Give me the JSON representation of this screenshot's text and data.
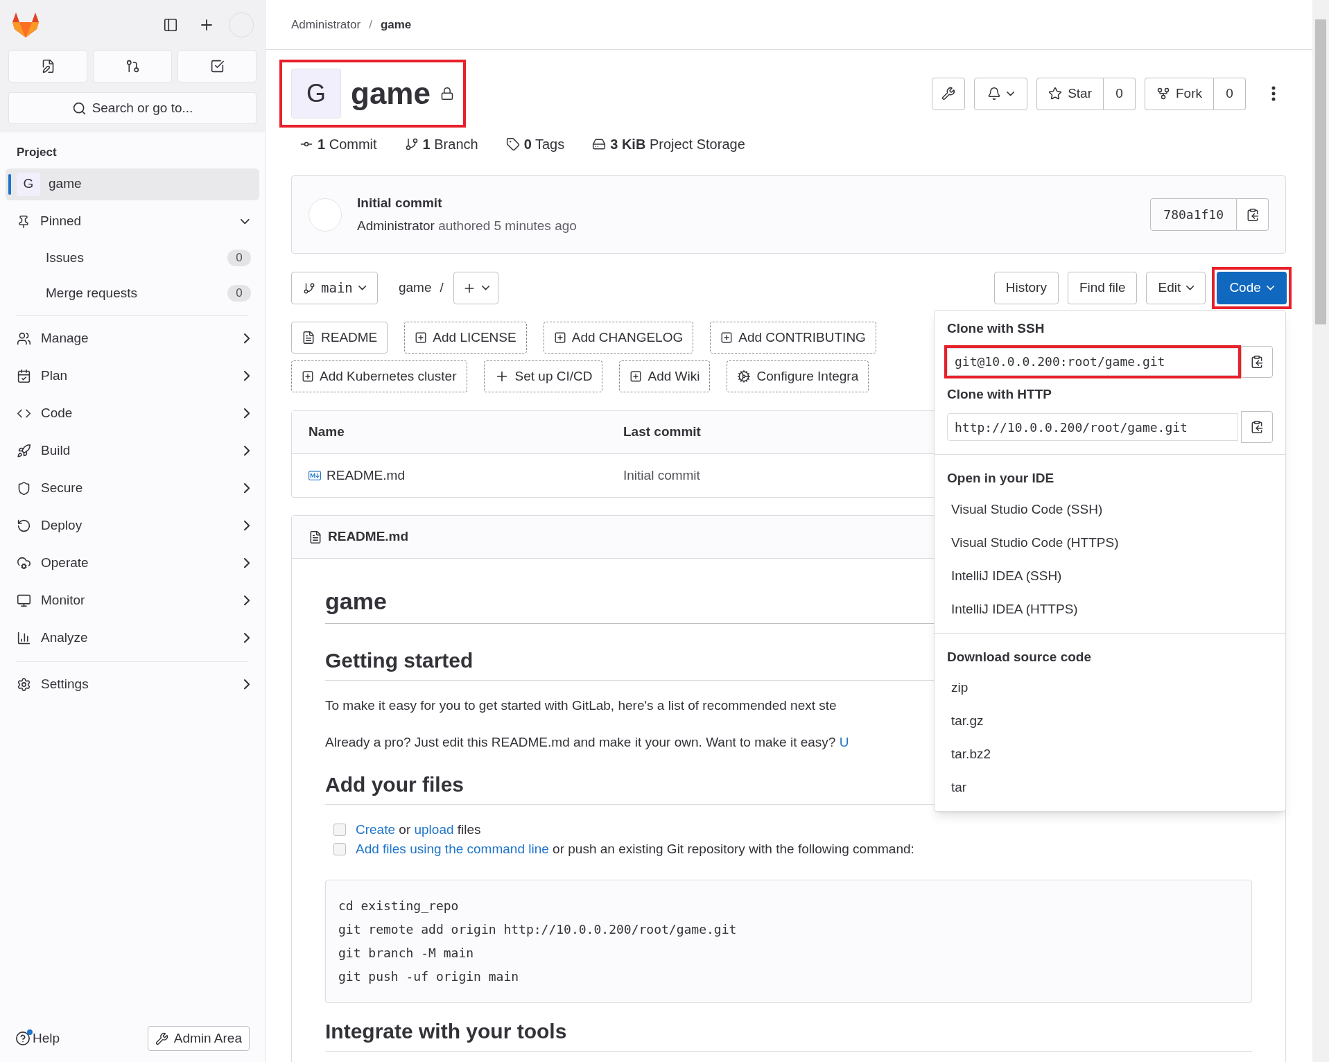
{
  "sidebar": {
    "search": {
      "placeholder": "Search or go to..."
    },
    "section_title": "Project",
    "items": [
      {
        "kind": "project",
        "avatar": "G",
        "label": "game",
        "selected": true
      },
      {
        "kind": "group",
        "label": "Pinned",
        "expanded": true,
        "children": [
          {
            "label": "Issues",
            "count": "0"
          },
          {
            "label": "Merge requests",
            "count": "0"
          }
        ]
      },
      {
        "kind": "divider"
      },
      {
        "kind": "nav",
        "label": "Manage"
      },
      {
        "kind": "nav",
        "label": "Plan"
      },
      {
        "kind": "nav",
        "label": "Code"
      },
      {
        "kind": "nav",
        "label": "Build"
      },
      {
        "kind": "nav",
        "label": "Secure"
      },
      {
        "kind": "nav",
        "label": "Deploy"
      },
      {
        "kind": "nav",
        "label": "Operate"
      },
      {
        "kind": "nav",
        "label": "Monitor"
      },
      {
        "kind": "nav",
        "label": "Analyze"
      },
      {
        "kind": "divider"
      },
      {
        "kind": "nav",
        "label": "Settings"
      }
    ],
    "help": {
      "label": "Help",
      "notification": true
    },
    "admin": "Admin Area"
  },
  "breadcrumb": {
    "items": [
      "Administrator",
      "game"
    ],
    "separator": "/"
  },
  "project": {
    "avatar": "G",
    "name": "game",
    "highlighted": true
  },
  "actions": {
    "star": {
      "label": "Star",
      "count": "0"
    },
    "fork": {
      "label": "Fork",
      "count": "0"
    }
  },
  "stats": [
    {
      "value": "1",
      "label": "Commit"
    },
    {
      "value": "1",
      "label": "Branch"
    },
    {
      "value": "0",
      "label": "Tags"
    },
    {
      "value": "3 KiB",
      "label": "Project Storage"
    }
  ],
  "commit": {
    "title": "Initial commit",
    "author": "Administrator",
    "meta": "authored 5 minutes ago",
    "sha": "780a1f10"
  },
  "toolbar": {
    "branch": "main",
    "path": "game",
    "separator": "/",
    "buttons": [
      "History",
      "Find file"
    ],
    "edit": "Edit",
    "code": {
      "label": "Code",
      "highlighted": true
    }
  },
  "shortcuts": [
    {
      "kind": "file",
      "label": "README"
    },
    {
      "kind": "add",
      "label": "Add LICENSE"
    },
    {
      "kind": "add",
      "label": "Add CHANGELOG"
    },
    {
      "kind": "add",
      "label": "Add CONTRIBUTING"
    },
    {
      "kind": "add",
      "label": "Add Kubernetes cluster"
    },
    {
      "kind": "plus",
      "label": "Set up CI/CD"
    },
    {
      "kind": "add",
      "label": "Add Wiki"
    },
    {
      "kind": "gear",
      "label": "Configure Integra"
    }
  ],
  "table": {
    "columns": [
      "Name",
      "Last commit"
    ],
    "rows": [
      {
        "name": "README.md",
        "last_commit": "Initial commit"
      }
    ]
  },
  "readme": {
    "filename": "README.md",
    "blocks": [
      {
        "kind": "h1",
        "text": "game"
      },
      {
        "kind": "h2",
        "text": "Getting started"
      },
      {
        "kind": "p",
        "parts": [
          {
            "text": "To make it easy for you to get started with GitLab, here's a list of recommended next ste"
          }
        ]
      },
      {
        "kind": "p",
        "parts": [
          {
            "text": "Already a pro? Just edit this README.md and make it your own. Want to make it easy? "
          },
          {
            "text": "U",
            "link": true
          }
        ]
      },
      {
        "kind": "h2",
        "text": "Add your files"
      },
      {
        "kind": "task",
        "checked": false,
        "parts": [
          {
            "text": "Create",
            "link": true
          },
          {
            "text": " or "
          },
          {
            "text": "upload",
            "link": true
          },
          {
            "text": " files"
          }
        ]
      },
      {
        "kind": "task",
        "checked": false,
        "parts": [
          {
            "text": "Add files using the command line",
            "link": true
          },
          {
            "text": " or push an existing Git repository with the following command:"
          }
        ]
      },
      {
        "kind": "code",
        "lines": [
          "cd existing_repo",
          "git remote add origin http://10.0.0.200/root/game.git",
          "git branch -M main",
          "git push -uf origin main"
        ]
      },
      {
        "kind": "h2",
        "text": "Integrate with your tools"
      }
    ]
  },
  "dropdown": {
    "clone": [
      {
        "title": "Clone with SSH",
        "value": "git@10.0.0.200:root/game.git",
        "highlighted": true
      },
      {
        "title": "Clone with HTTP",
        "value": "http://10.0.0.200/root/game.git",
        "highlighted": false
      }
    ],
    "ide": {
      "title": "Open in your IDE",
      "items": [
        "Visual Studio Code (SSH)",
        "Visual Studio Code (HTTPS)",
        "IntelliJ IDEA (SSH)",
        "IntelliJ IDEA (HTTPS)"
      ]
    },
    "download": {
      "title": "Download source code",
      "items": [
        "zip",
        "tar.gz",
        "tar.bz2",
        "tar"
      ]
    }
  }
}
